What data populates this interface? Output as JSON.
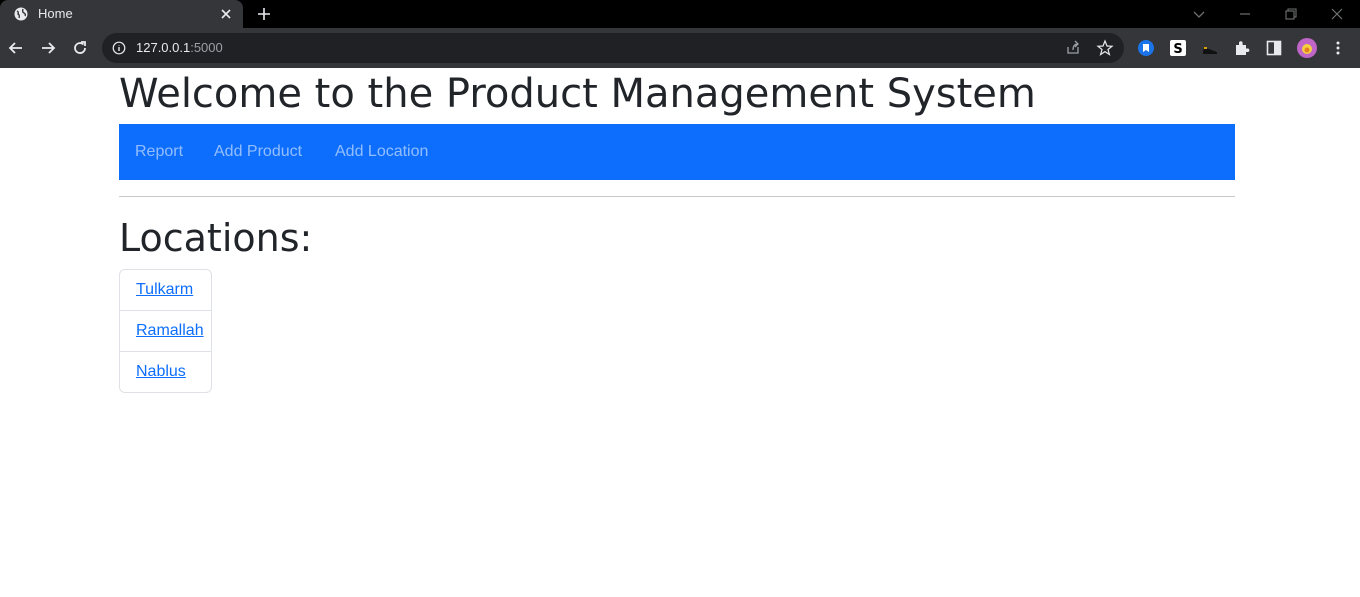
{
  "browser": {
    "tab_title": "Home",
    "url_host": "127.0.0.1",
    "url_port": ":5000"
  },
  "page": {
    "title": "Welcome to the Product Management System",
    "nav": [
      "Report",
      "Add Product",
      "Add Location"
    ],
    "locations_heading": "Locations:",
    "locations": [
      "Tulkarm",
      "Ramallah",
      "Nablus"
    ]
  },
  "colors": {
    "navbar": "#0d6efd",
    "link": "#0d6efd",
    "chrome_dark": "#35363a"
  }
}
